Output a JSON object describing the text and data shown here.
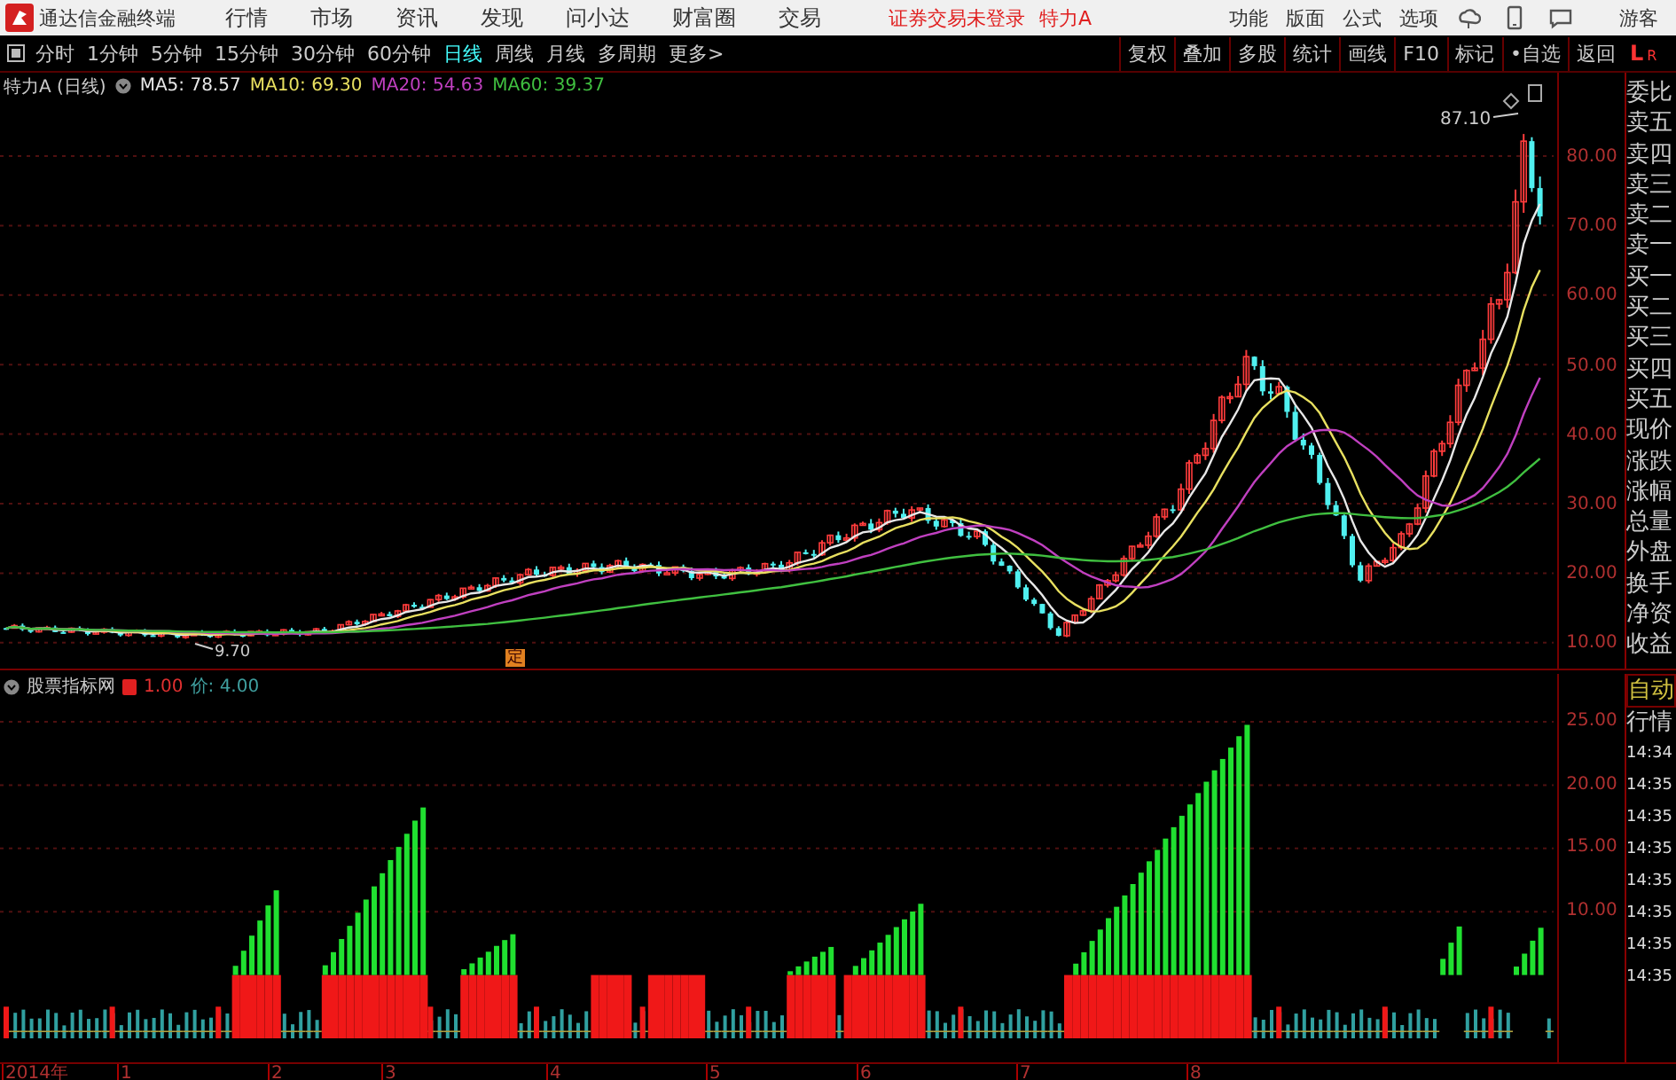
{
  "title_bar": {
    "app_name": "通达信金融终端",
    "menu": [
      "行情",
      "市场",
      "资讯",
      "发现",
      "问小达",
      "财富圈",
      "交易"
    ],
    "notice": "证券交易未登录",
    "stock_name": "特力A",
    "tools": [
      "功能",
      "版面",
      "公式",
      "选项"
    ],
    "user": "游客"
  },
  "toolbar": {
    "periods": [
      {
        "label": "分时",
        "selected": false
      },
      {
        "label": "1分钟",
        "selected": false
      },
      {
        "label": "5分钟",
        "selected": false
      },
      {
        "label": "15分钟",
        "selected": false
      },
      {
        "label": "30分钟",
        "selected": false
      },
      {
        "label": "60分钟",
        "selected": false
      },
      {
        "label": "日线",
        "selected": true
      },
      {
        "label": "周线",
        "selected": false
      },
      {
        "label": "月线",
        "selected": false
      },
      {
        "label": "多周期",
        "selected": false
      },
      {
        "label": "更多>",
        "selected": false
      }
    ],
    "buttons": [
      "复权",
      "叠加",
      "多股",
      "统计",
      "画线",
      "F10",
      "标记",
      "•自选",
      "返回"
    ],
    "corner": [
      "L",
      "R"
    ]
  },
  "price_panel": {
    "title": "特力A (日线)",
    "ma": [
      {
        "label": "MA5: 78.57",
        "color": "#e8e8e8"
      },
      {
        "label": "MA10: 69.30",
        "color": "#e8e060"
      },
      {
        "label": "MA20: 54.63",
        "color": "#c040c0"
      },
      {
        "label": "MA60: 39.37",
        "color": "#40c040"
      }
    ],
    "y_labels": [
      "80.00",
      "70.00",
      "60.00",
      "50.00",
      "40.00",
      "30.00",
      "20.00",
      "10.00"
    ],
    "high_note": "87.10",
    "low_note": "9.70",
    "marker": "定"
  },
  "quote_panel": {
    "labels": [
      "委比",
      "卖五",
      "卖四",
      "卖三",
      "卖二",
      "卖一",
      "买一",
      "买二",
      "买三",
      "买四",
      "买五",
      "现价",
      "涨跌",
      "涨幅",
      "总量",
      "外盘",
      "换手",
      "净资",
      "收益"
    ]
  },
  "indicator_panel": {
    "title": "股票指标网",
    "value_1": "1.00",
    "value_2": "价: 4.00",
    "y_labels": [
      "25.00",
      "20.00",
      "15.00",
      "10.00"
    ]
  },
  "trade_panel": {
    "tabs": [
      "自动",
      "行情"
    ],
    "times": [
      "14:34",
      "14:35",
      "14:35",
      "14:35",
      "14:35",
      "14:35",
      "14:35",
      "14:35"
    ]
  },
  "x_axis": {
    "labels": [
      "2014年",
      "1",
      "2",
      "3",
      "4",
      "5",
      "6",
      "7",
      "8"
    ]
  }
}
